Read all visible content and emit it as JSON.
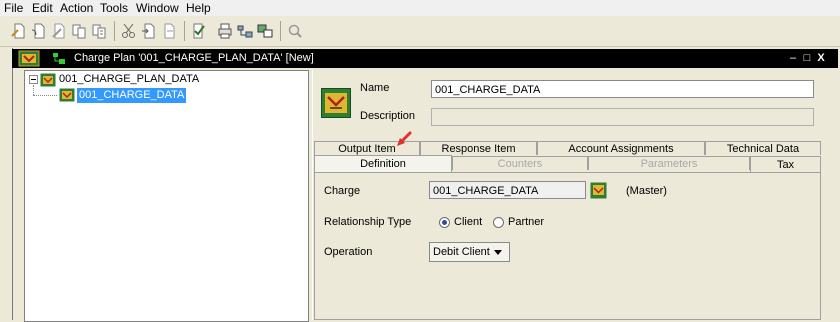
{
  "menu": [
    "File",
    "Edit",
    "Action",
    "Tools",
    "Window",
    "Help"
  ],
  "toolbar": {
    "icons": [
      "new-icon",
      "open-icon",
      "edit-icon",
      "copy-icon",
      "paste-icon",
      "cut-icon",
      "export-icon",
      "import-icon",
      "check-icon",
      "print-icon",
      "tree-icon",
      "translate-icon",
      "search-icon"
    ]
  },
  "window": {
    "title": "Charge Plan '001_CHARGE_PLAN_DATA' [New]",
    "controls": [
      "–",
      "□",
      "X"
    ]
  },
  "tree": {
    "root": "001_CHARGE_PLAN_DATA",
    "child": "001_CHARGE_DATA"
  },
  "header": {
    "name_label": "Name",
    "name_value": "001_CHARGE_DATA",
    "description_label": "Description",
    "description_value": ""
  },
  "tabs": {
    "row1": [
      "Output Item",
      "Response Item",
      "Account Assignments",
      "Technical Data"
    ],
    "row2": [
      "Definition",
      "Counters",
      "Parameters",
      "Tax"
    ]
  },
  "definition": {
    "charge_label": "Charge",
    "charge_value": "001_CHARGE_DATA",
    "charge_note": "(Master)",
    "relationship_label": "Relationship Type",
    "relationship_options": [
      "Client",
      "Partner"
    ],
    "relationship_selected": "Client",
    "operation_label": "Operation",
    "operation_value": "Debit Client"
  },
  "colors": {
    "titlebar": "#000000",
    "selection": "#3399ff",
    "pointer_arrow": "#e03030"
  }
}
